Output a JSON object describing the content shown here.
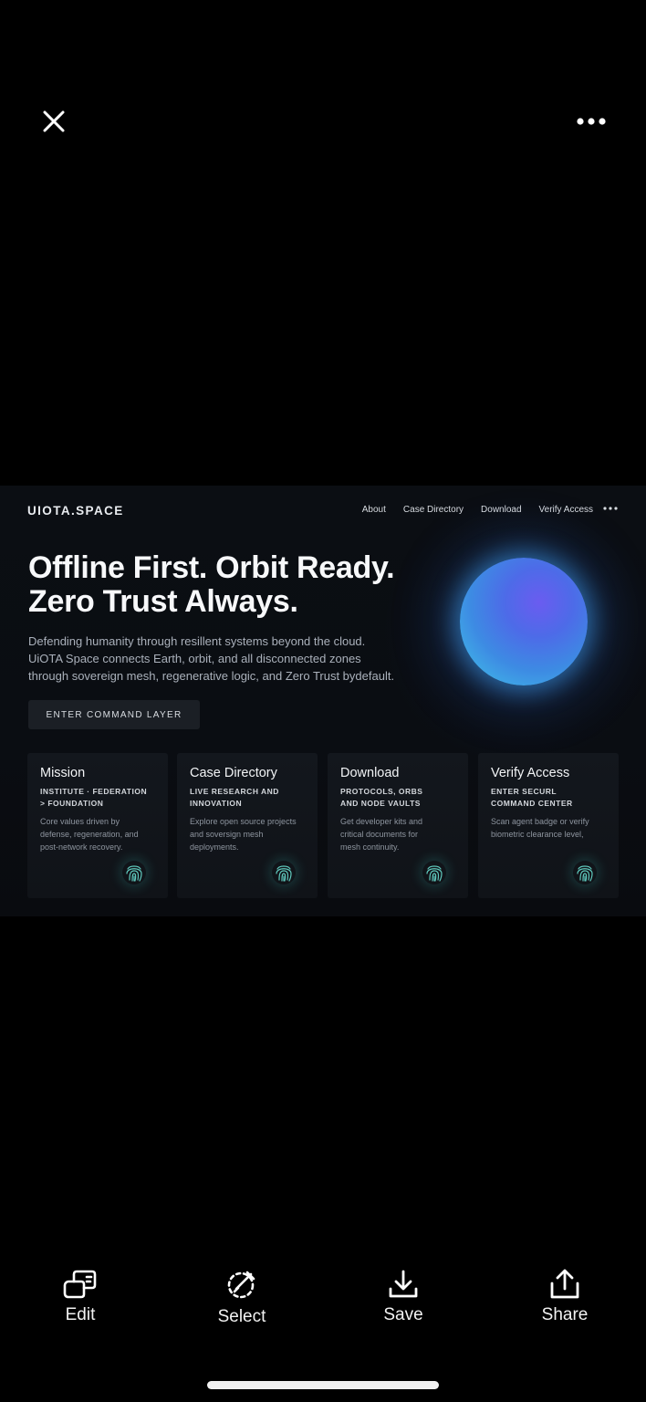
{
  "viewer": {
    "top_controls": {
      "close_icon": "close-icon",
      "more_icon": "more-horizontal-icon"
    },
    "toolbar": [
      {
        "label": "Edit",
        "icon": "edit-icon"
      },
      {
        "label": "Select",
        "icon": "select-icon"
      },
      {
        "label": "Save",
        "icon": "download-icon"
      },
      {
        "label": "Share",
        "icon": "share-icon"
      }
    ]
  },
  "site": {
    "logo": "UIOTA.SPACE",
    "nav": [
      "About",
      "Case Directory",
      "Download",
      "Verify Access"
    ],
    "hero": {
      "title_lines": [
        "Offline First. Orbit Ready.",
        "Zero Trust Always."
      ],
      "description_lines": [
        "Defending humanity through resillent systems beyond the cloud.",
        "UiOTA Space connects Earth, orbit, and all disconnected zones",
        "through sovereign mesh, regenerative logic, and Zero Trust bydefault."
      ],
      "cta": "ENTER COMMAND LAYER"
    },
    "cards": [
      {
        "title": "Mission",
        "subtitle_lines": [
          "INSTITUTE · FEDERATION",
          "> FOUNDATION"
        ],
        "description_lines": [
          "Core values driven by",
          "defense, regeneration, and",
          "post-network recovery."
        ]
      },
      {
        "title": "Case Directory",
        "subtitle_lines": [
          "LIVE RESEARCH AND",
          "INNOVATION"
        ],
        "description_lines": [
          "Explore open source projects",
          "and soversign mesh",
          "deployments."
        ]
      },
      {
        "title": "Download",
        "subtitle_lines": [
          "PROTOCOLS, ORBS",
          "AND NODE VAULTS"
        ],
        "description_lines": [
          "Get developer kits and",
          "critical documents for",
          "mesh continuity."
        ]
      },
      {
        "title": "Verify Access",
        "subtitle_lines": [
          "ENTER SECURL",
          "COMMAND CENTER"
        ],
        "description_lines": [
          "Scan agent badge or verify",
          "biometric clearance level,"
        ]
      }
    ],
    "colors": {
      "background": "#0a0d12",
      "orb_inner": "#6a5cf0",
      "orb_outer": "#41c7e9",
      "fingerprint": "#5fc9bd"
    }
  }
}
